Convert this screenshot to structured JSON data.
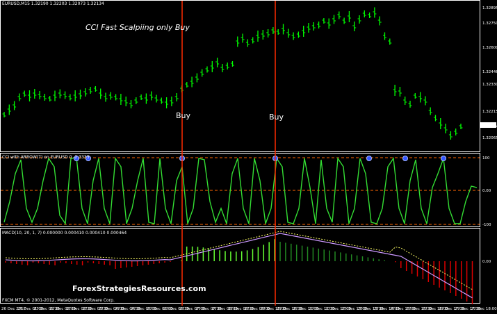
{
  "symbol_header": "EURUSD,M15  1.32190 1.32203 1.32073 1.32134",
  "title": "CCI Fast Scalpiing only Buy",
  "buy_labels": [
    "Buy",
    "Buy"
  ],
  "cci_header": "CCI with ARROW(7) on EURUSD 0 -2.3333",
  "macd_header": "MACD(10, 20, 1, 7) 0.000000 0.000410 0.000410 0.000464",
  "copyright": "FXCM MT4, © 2001-2012, MetaQuotes Software Corp.",
  "watermark": "ForexStrategiesResources.com",
  "price_ticks": [
    "1.32895",
    "1.32750",
    "1.32600",
    "1.32446",
    "1.32330",
    "1.32215",
    "1.32134",
    "1.32065"
  ],
  "cci_ticks": [
    "100",
    "0.00",
    "-100"
  ],
  "macd_ticks": [
    "0.00"
  ],
  "time_ticks": [
    "26 Dec 2012",
    "27 Dec 01:00",
    "27 Dec 01:30",
    "27 Dec 02:00",
    "27 Dec 02:30",
    "27 Dec 03:30",
    "27 Dec 04:00",
    "27 Dec 04:30",
    "27 Dec 05:00",
    "27 Dec 06:00",
    "27 Dec 06:30",
    "27 Dec 07:00",
    "27 Dec 07:30",
    "27 Dec 08:00",
    "27 Dec 08:30",
    "27 Dec 09:00",
    "27 Dec 10:00",
    "27 Dec 10:30",
    "27 Dec 11:00",
    "27 Dec 11:30",
    "27 Dec 12:00",
    "27 Dec 13:00",
    "27 Dec 13:30",
    "27 Dec 14:00",
    "27 Dec 15:00",
    "27 Dec 15:30",
    "27 Dec 16:00",
    "27 Dec 17:00",
    "27 Dec 17:30",
    "27 Dec 18:00"
  ],
  "colors": {
    "background": "#000000",
    "bars": "#00ff00",
    "buy_line": "#ff2a00",
    "cci_line": "#33dd33",
    "level_line": "#ff6600",
    "macd_pos": "#66ff33",
    "macd_neg": "#dd0000",
    "signal": "#ffff66",
    "macd_line": "#cc99ff",
    "price_marker_bg": "#ffffff"
  }
}
